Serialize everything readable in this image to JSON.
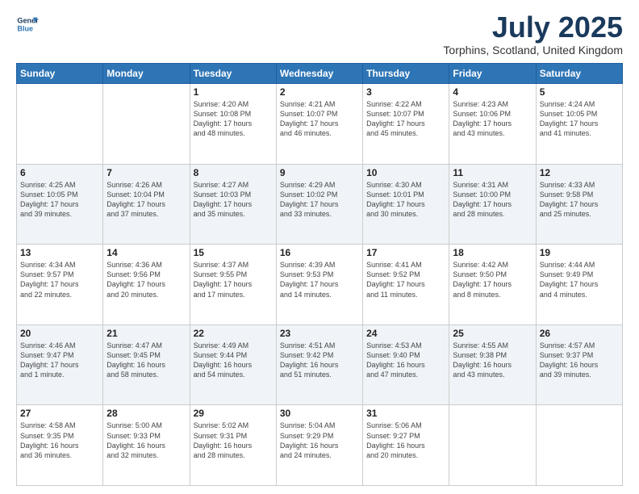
{
  "header": {
    "logo_line1": "General",
    "logo_line2": "Blue",
    "title": "July 2025",
    "subtitle": "Torphins, Scotland, United Kingdom"
  },
  "days_of_week": [
    "Sunday",
    "Monday",
    "Tuesday",
    "Wednesday",
    "Thursday",
    "Friday",
    "Saturday"
  ],
  "weeks": [
    [
      {
        "day": "",
        "info": ""
      },
      {
        "day": "",
        "info": ""
      },
      {
        "day": "1",
        "info": "Sunrise: 4:20 AM\nSunset: 10:08 PM\nDaylight: 17 hours\nand 48 minutes."
      },
      {
        "day": "2",
        "info": "Sunrise: 4:21 AM\nSunset: 10:07 PM\nDaylight: 17 hours\nand 46 minutes."
      },
      {
        "day": "3",
        "info": "Sunrise: 4:22 AM\nSunset: 10:07 PM\nDaylight: 17 hours\nand 45 minutes."
      },
      {
        "day": "4",
        "info": "Sunrise: 4:23 AM\nSunset: 10:06 PM\nDaylight: 17 hours\nand 43 minutes."
      },
      {
        "day": "5",
        "info": "Sunrise: 4:24 AM\nSunset: 10:05 PM\nDaylight: 17 hours\nand 41 minutes."
      }
    ],
    [
      {
        "day": "6",
        "info": "Sunrise: 4:25 AM\nSunset: 10:05 PM\nDaylight: 17 hours\nand 39 minutes."
      },
      {
        "day": "7",
        "info": "Sunrise: 4:26 AM\nSunset: 10:04 PM\nDaylight: 17 hours\nand 37 minutes."
      },
      {
        "day": "8",
        "info": "Sunrise: 4:27 AM\nSunset: 10:03 PM\nDaylight: 17 hours\nand 35 minutes."
      },
      {
        "day": "9",
        "info": "Sunrise: 4:29 AM\nSunset: 10:02 PM\nDaylight: 17 hours\nand 33 minutes."
      },
      {
        "day": "10",
        "info": "Sunrise: 4:30 AM\nSunset: 10:01 PM\nDaylight: 17 hours\nand 30 minutes."
      },
      {
        "day": "11",
        "info": "Sunrise: 4:31 AM\nSunset: 10:00 PM\nDaylight: 17 hours\nand 28 minutes."
      },
      {
        "day": "12",
        "info": "Sunrise: 4:33 AM\nSunset: 9:58 PM\nDaylight: 17 hours\nand 25 minutes."
      }
    ],
    [
      {
        "day": "13",
        "info": "Sunrise: 4:34 AM\nSunset: 9:57 PM\nDaylight: 17 hours\nand 22 minutes."
      },
      {
        "day": "14",
        "info": "Sunrise: 4:36 AM\nSunset: 9:56 PM\nDaylight: 17 hours\nand 20 minutes."
      },
      {
        "day": "15",
        "info": "Sunrise: 4:37 AM\nSunset: 9:55 PM\nDaylight: 17 hours\nand 17 minutes."
      },
      {
        "day": "16",
        "info": "Sunrise: 4:39 AM\nSunset: 9:53 PM\nDaylight: 17 hours\nand 14 minutes."
      },
      {
        "day": "17",
        "info": "Sunrise: 4:41 AM\nSunset: 9:52 PM\nDaylight: 17 hours\nand 11 minutes."
      },
      {
        "day": "18",
        "info": "Sunrise: 4:42 AM\nSunset: 9:50 PM\nDaylight: 17 hours\nand 8 minutes."
      },
      {
        "day": "19",
        "info": "Sunrise: 4:44 AM\nSunset: 9:49 PM\nDaylight: 17 hours\nand 4 minutes."
      }
    ],
    [
      {
        "day": "20",
        "info": "Sunrise: 4:46 AM\nSunset: 9:47 PM\nDaylight: 17 hours\nand 1 minute."
      },
      {
        "day": "21",
        "info": "Sunrise: 4:47 AM\nSunset: 9:45 PM\nDaylight: 16 hours\nand 58 minutes."
      },
      {
        "day": "22",
        "info": "Sunrise: 4:49 AM\nSunset: 9:44 PM\nDaylight: 16 hours\nand 54 minutes."
      },
      {
        "day": "23",
        "info": "Sunrise: 4:51 AM\nSunset: 9:42 PM\nDaylight: 16 hours\nand 51 minutes."
      },
      {
        "day": "24",
        "info": "Sunrise: 4:53 AM\nSunset: 9:40 PM\nDaylight: 16 hours\nand 47 minutes."
      },
      {
        "day": "25",
        "info": "Sunrise: 4:55 AM\nSunset: 9:38 PM\nDaylight: 16 hours\nand 43 minutes."
      },
      {
        "day": "26",
        "info": "Sunrise: 4:57 AM\nSunset: 9:37 PM\nDaylight: 16 hours\nand 39 minutes."
      }
    ],
    [
      {
        "day": "27",
        "info": "Sunrise: 4:58 AM\nSunset: 9:35 PM\nDaylight: 16 hours\nand 36 minutes."
      },
      {
        "day": "28",
        "info": "Sunrise: 5:00 AM\nSunset: 9:33 PM\nDaylight: 16 hours\nand 32 minutes."
      },
      {
        "day": "29",
        "info": "Sunrise: 5:02 AM\nSunset: 9:31 PM\nDaylight: 16 hours\nand 28 minutes."
      },
      {
        "day": "30",
        "info": "Sunrise: 5:04 AM\nSunset: 9:29 PM\nDaylight: 16 hours\nand 24 minutes."
      },
      {
        "day": "31",
        "info": "Sunrise: 5:06 AM\nSunset: 9:27 PM\nDaylight: 16 hours\nand 20 minutes."
      },
      {
        "day": "",
        "info": ""
      },
      {
        "day": "",
        "info": ""
      }
    ]
  ]
}
